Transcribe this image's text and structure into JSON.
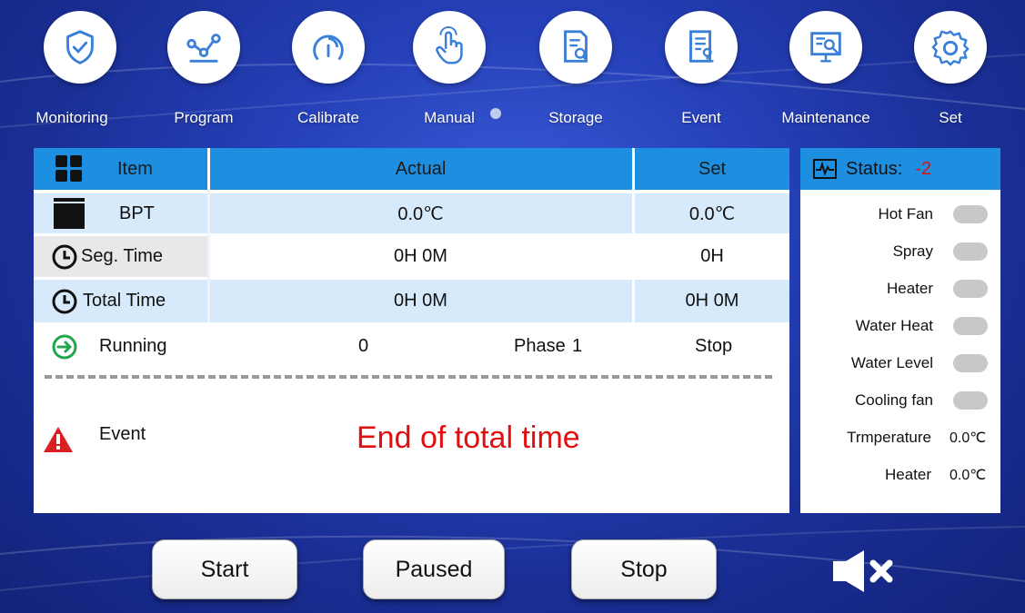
{
  "nav": {
    "items": [
      {
        "label": "Monitoring",
        "icon": "shield-check-icon"
      },
      {
        "label": "Program",
        "icon": "graph-nodes-icon"
      },
      {
        "label": "Calibrate",
        "icon": "gauge-icon"
      },
      {
        "label": "Manual",
        "icon": "hand-pointer-icon"
      },
      {
        "label": "Storage",
        "icon": "document-search-icon"
      },
      {
        "label": "Event",
        "icon": "document-stamp-icon"
      },
      {
        "label": "Maintenance",
        "icon": "screen-wrench-icon"
      },
      {
        "label": "Set",
        "icon": "gear-icon"
      }
    ]
  },
  "table": {
    "headers": {
      "item": "Item",
      "actual": "Actual",
      "set": "Set"
    },
    "rows": [
      {
        "item": "BPT",
        "actual": "0.0℃",
        "set": "0.0℃"
      },
      {
        "item": "Seg. Time",
        "actual": "0H 0M",
        "set": "0H"
      },
      {
        "item": "Total Time",
        "actual": "0H 0M",
        "set": "0H 0M"
      }
    ]
  },
  "running": {
    "label": "Running",
    "value": "0",
    "phase_label": "Phase",
    "phase_value": "1",
    "state": "Stop"
  },
  "event": {
    "label": "Event",
    "message": "End of total time"
  },
  "status": {
    "label": "Status:",
    "code": "-2",
    "toggles": [
      {
        "label": "Hot Fan"
      },
      {
        "label": "Spray"
      },
      {
        "label": "Heater"
      },
      {
        "label": "Water Heat"
      },
      {
        "label": "Water Level"
      },
      {
        "label": "Cooling fan"
      }
    ],
    "readings": [
      {
        "label": "Trmperature",
        "value": "0.0℃"
      },
      {
        "label": "Heater",
        "value": "0.0℃"
      }
    ]
  },
  "buttons": {
    "start": "Start",
    "paused": "Paused",
    "stop": "Stop"
  },
  "colors": {
    "header_blue": "#1e8fe0",
    "row_light": "#d6eafc",
    "event_red": "#e01010",
    "status_code_red": "#e01010"
  }
}
